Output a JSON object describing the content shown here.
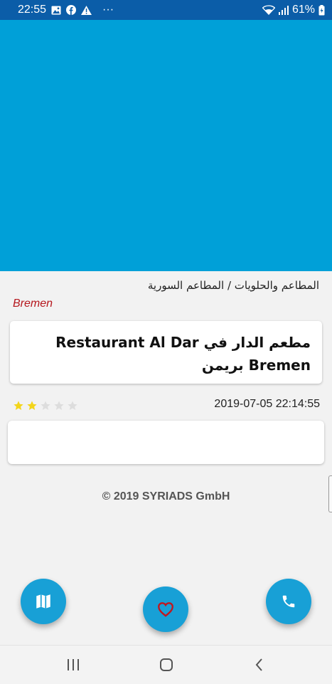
{
  "status_bar": {
    "time": "22:55",
    "overflow": "···",
    "battery": "61%",
    "left_icons": [
      "gallery-icon",
      "facebook-icon",
      "warning-icon"
    ],
    "right_icons": [
      "wifi-icon",
      "signal-icon",
      "battery-icon"
    ]
  },
  "colors": {
    "status_bar": "#0b5da8",
    "hero": "#00a0d8",
    "accent": "#18a0d6",
    "city": "#b5171d",
    "star_filled": "#f3d51a",
    "star_empty": "#dddddd"
  },
  "listing": {
    "category": "المطاعم والحلويات / المطاعم السورية",
    "city": "Bremen",
    "title": "مطعم الدار في Restaurant Al Dar Bremen بريمن",
    "rating": 2,
    "rating_max": 5,
    "date": "2019-07-05 22:14:55",
    "description": ""
  },
  "footer": {
    "copyright": "© 2019 SYRIADS GmbH"
  },
  "fabs": {
    "map_icon": "map-icon",
    "favorite_icon": "heart-icon",
    "call_icon": "phone-icon"
  },
  "nav": {
    "recent_icon": "recent-apps-icon",
    "home_icon": "home-icon",
    "back_icon": "back-icon"
  }
}
